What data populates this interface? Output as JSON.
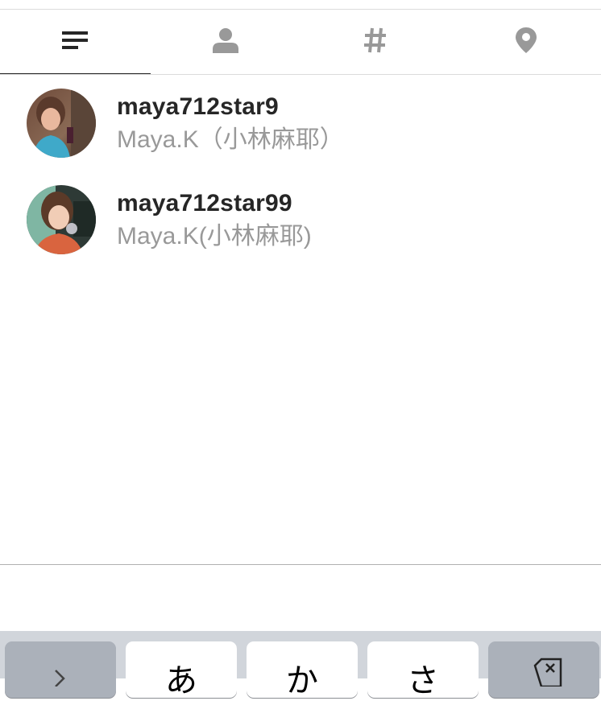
{
  "tabs": [
    {
      "name": "top",
      "icon": "list-icon",
      "active": true
    },
    {
      "name": "people",
      "icon": "person-icon",
      "active": false
    },
    {
      "name": "tags",
      "icon": "hashtag-icon",
      "active": false
    },
    {
      "name": "places",
      "icon": "location-pin-icon",
      "active": false
    }
  ],
  "results": [
    {
      "username": "maya712star9",
      "full_name": "Maya.K（小林麻耶）"
    },
    {
      "username": "maya712star99",
      "full_name": "Maya.K(小林麻耶)"
    }
  ],
  "keyboard": {
    "keys": [
      {
        "label": "",
        "icon": "arrow-right-icon"
      },
      {
        "label": "あ"
      },
      {
        "label": "か"
      },
      {
        "label": "さ"
      },
      {
        "label": "",
        "icon": "delete-icon"
      }
    ]
  },
  "colors": {
    "text_primary": "#262626",
    "text_secondary": "#999999",
    "divider": "#dbdbdb",
    "keyboard_bg": "#d1d5db",
    "key_special": "#abb1ba"
  }
}
